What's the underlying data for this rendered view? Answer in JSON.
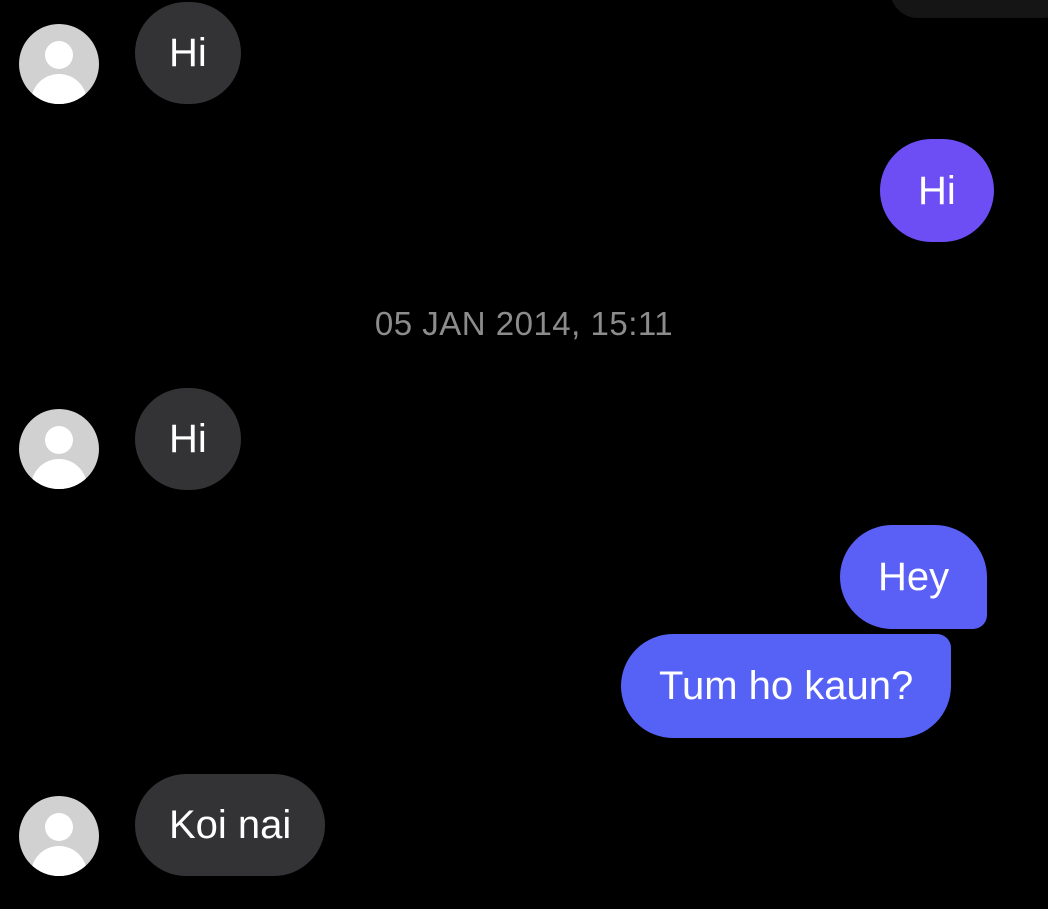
{
  "colors": {
    "background": "#000000",
    "incoming_bubble": "#333335",
    "outgoing_violet": "#6d4ef5",
    "outgoing_blue": "#5662f6",
    "timestamp_text": "#8c8c8c",
    "avatar": "#d1d1d1"
  },
  "conversation": {
    "messages": [
      {
        "text": "Hi",
        "direction": "incoming",
        "avatar_icon": "person-placeholder-icon"
      },
      {
        "text": "Hi",
        "direction": "outgoing"
      },
      {
        "text": "Hi",
        "direction": "incoming",
        "avatar_icon": "person-placeholder-icon"
      },
      {
        "text": "Hey",
        "direction": "outgoing"
      },
      {
        "text": "Tum ho kaun?",
        "direction": "outgoing"
      },
      {
        "text": "Koi nai",
        "direction": "incoming",
        "avatar_icon": "person-placeholder-icon"
      }
    ],
    "timestamp": "05 JAN 2014, 15:11"
  }
}
